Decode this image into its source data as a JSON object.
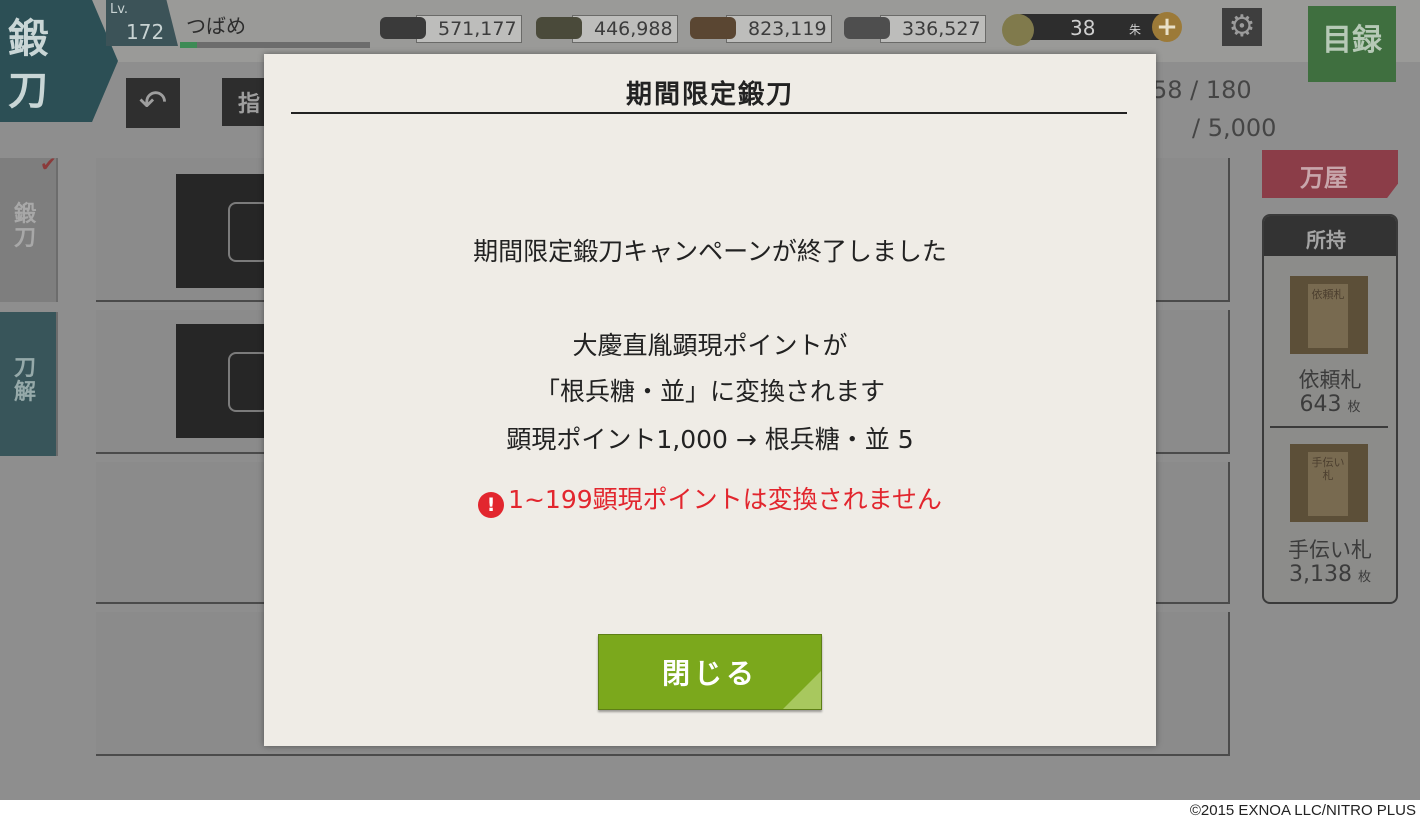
{
  "header": {
    "mode_title": [
      "鍛",
      "刀"
    ],
    "level_label": "Lv.",
    "level_value": "172",
    "player_name": "つばめ",
    "exp_progress": 0.09,
    "resources": [
      {
        "icon": "charcoal-icon",
        "value": "571,177"
      },
      {
        "icon": "tamahagane-icon",
        "value": "446,988"
      },
      {
        "icon": "cooling-material-icon",
        "value": "823,119"
      },
      {
        "icon": "whetstone-icon",
        "value": "336,527"
      }
    ],
    "koban": {
      "icon": "koban-coin-icon",
      "value": "38",
      "unit": "朱"
    },
    "catalog_label": "目録"
  },
  "toolbar": {
    "tab_label": "指",
    "sword_count": "58 /  180",
    "points_count": "/ 5,000"
  },
  "side_tabs": [
    {
      "label": "鍛刀"
    },
    {
      "label": "刀解"
    }
  ],
  "right_panel": {
    "shop_label": "万屋",
    "owned_label": "所持",
    "items": [
      {
        "ticket_text": "依頼札",
        "name": "依頼札",
        "count": "643",
        "unit": "枚"
      },
      {
        "ticket_text": "手伝い札",
        "name": "手伝い札",
        "count": "3,138",
        "unit": "枚"
      }
    ]
  },
  "modal": {
    "title": "期間限定鍛刀",
    "line1": "期間限定鍛刀キャンペーンが終了しました",
    "line2": "大慶直胤顕現ポイントが",
    "line3": "「根兵糖・並」に変換されます",
    "line4": "顕現ポイント1,000 → 根兵糖・並 5",
    "warning_icon": "!",
    "warning": "1~199顕現ポイントは変換されません",
    "close_label": "閉じる"
  },
  "footer": {
    "copyright": "©2015 EXNOA LLC/NITRO PLUS"
  },
  "colors": {
    "accent_green": "#7ba81c",
    "warning_red": "#e2262e",
    "modal_bg": "#efece6"
  }
}
